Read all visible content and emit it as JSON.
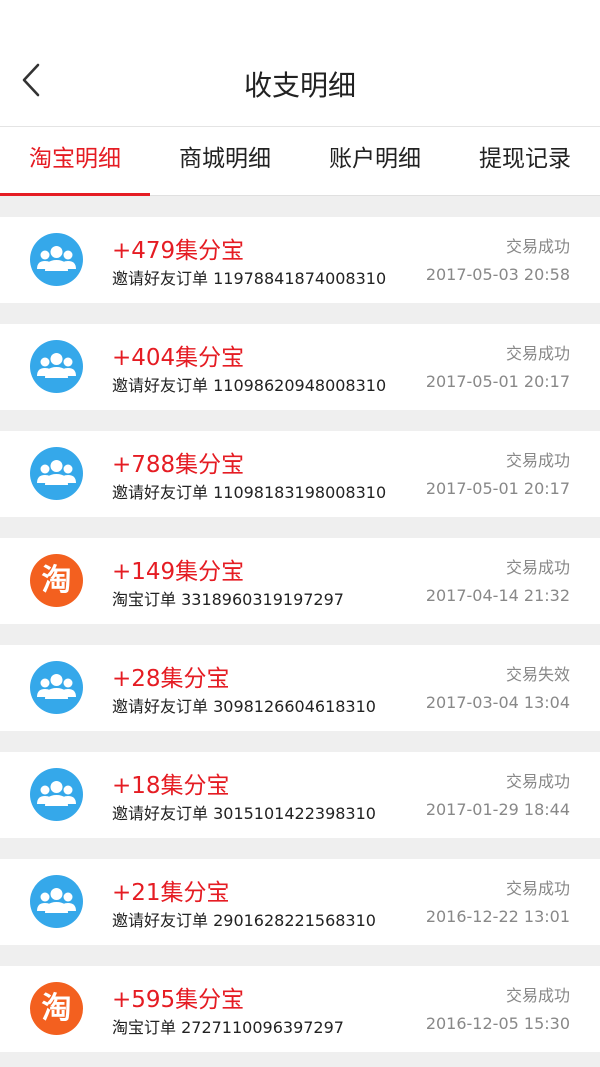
{
  "header": {
    "title": "收支明细"
  },
  "tabs": [
    {
      "label": "淘宝明细",
      "active": true
    },
    {
      "label": "商城明细",
      "active": false
    },
    {
      "label": "账户明细",
      "active": false
    },
    {
      "label": "提现记录",
      "active": false
    }
  ],
  "records": [
    {
      "icon": "group-icon",
      "amount": "+479集分宝",
      "desc": "邀请好友订单 11978841874008310",
      "status": "交易成功",
      "time": "2017-05-03 20:58"
    },
    {
      "icon": "group-icon",
      "amount": "+404集分宝",
      "desc": "邀请好友订单 11098620948008310",
      "status": "交易成功",
      "time": "2017-05-01 20:17"
    },
    {
      "icon": "group-icon",
      "amount": "+788集分宝",
      "desc": "邀请好友订单 11098183198008310",
      "status": "交易成功",
      "time": "2017-05-01 20:17"
    },
    {
      "icon": "taobao-icon",
      "glyph": "淘",
      "amount": "+149集分宝",
      "desc": "淘宝订单 3318960319197297",
      "status": "交易成功",
      "time": "2017-04-14 21:32"
    },
    {
      "icon": "group-icon",
      "amount": "+28集分宝",
      "desc": "邀请好友订单 3098126604618310",
      "status": "交易失效",
      "time": "2017-03-04 13:04"
    },
    {
      "icon": "group-icon",
      "amount": "+18集分宝",
      "desc": "邀请好友订单 3015101422398310",
      "status": "交易成功",
      "time": "2017-01-29 18:44"
    },
    {
      "icon": "group-icon",
      "amount": "+21集分宝",
      "desc": "邀请好友订单 2901628221568310",
      "status": "交易成功",
      "time": "2016-12-22 13:01"
    },
    {
      "icon": "taobao-icon",
      "glyph": "淘",
      "amount": "+595集分宝",
      "desc": "淘宝订单 2727110096397297",
      "status": "交易成功",
      "time": "2016-12-05 15:30"
    }
  ]
}
